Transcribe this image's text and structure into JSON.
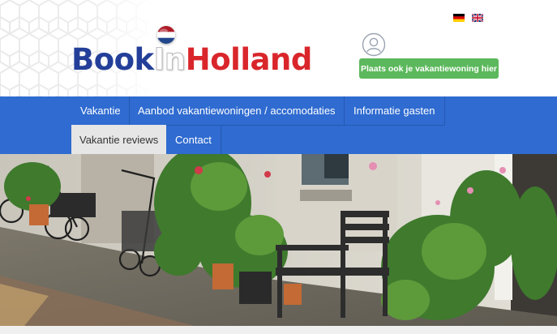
{
  "brand": {
    "book": "Book",
    "in": "In",
    "holland": "Holland"
  },
  "language_flags": [
    {
      "icon": "german-flag-icon",
      "colors": [
        "#000000",
        "#dd0000",
        "#ffce00"
      ]
    },
    {
      "icon": "british-flag-icon",
      "colors": [
        "#012169",
        "#ffffff",
        "#c8102e"
      ]
    }
  ],
  "header": {
    "account_icon": "user-account-icon",
    "cta_label": "Plaats ook je vakantiewoning hier"
  },
  "nav": {
    "items": [
      {
        "label": "Vakantie",
        "active": false
      },
      {
        "label": "Aanbod vakantiewoningen / accomodaties",
        "active": false
      },
      {
        "label": "Informatie gasten",
        "active": false
      },
      {
        "label": "Vakantie reviews",
        "active": true
      },
      {
        "label": "Contact",
        "active": false
      }
    ]
  },
  "colors": {
    "brand_blue": "#233f99",
    "brand_red": "#d9262b",
    "nav_blue": "#2f6bd0",
    "cta_green": "#5cb85c",
    "active_tab": "#e6e6e6"
  }
}
